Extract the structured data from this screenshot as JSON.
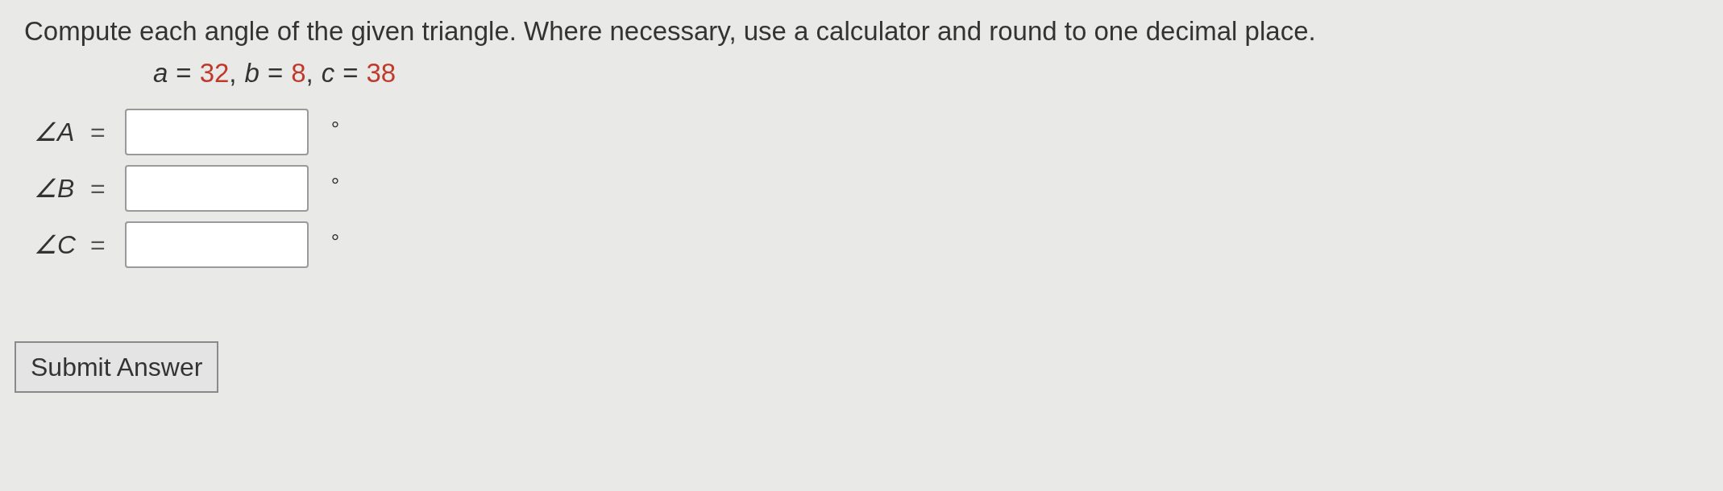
{
  "question": "Compute each angle of the given triangle. Where necessary, use a calculator and round to one decimal place.",
  "given": [
    {
      "name": "a",
      "sign": "=",
      "value": "32",
      "separator": ","
    },
    {
      "name": "b",
      "sign": "=",
      "value": "8",
      "separator": ","
    },
    {
      "name": "c",
      "sign": "=",
      "value": "38"
    }
  ],
  "answers": [
    {
      "label": "∠A",
      "sign": "=",
      "unit": "°"
    },
    {
      "label": "∠B",
      "sign": "=",
      "unit": "°"
    },
    {
      "label": "∠C",
      "sign": "=",
      "unit": "°"
    }
  ],
  "submit_button": "Submit Answer"
}
